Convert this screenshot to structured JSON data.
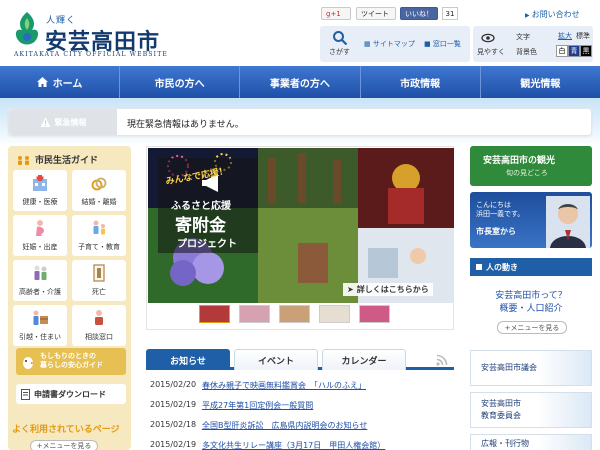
{
  "header": {
    "logo_small": "人輝く",
    "logo_main": "安芸高田市",
    "logo_en": "AKITAKATA CITY OFFICIAL WEBSITE",
    "social": {
      "gplus": "g+1",
      "tweet": "ツイート",
      "like": "いいね！",
      "like_count": "31"
    },
    "contact": "お問い合わせ",
    "search_label": "さがす",
    "sitemap": "サイトマップ",
    "counter": "窓口一覧",
    "view_label": "見やすく",
    "text_label": "文字",
    "bg_label": "背景色",
    "size_big": "拡大",
    "size_std": "標準",
    "bg_white": "白",
    "bg_blue": "青",
    "bg_black": "黒"
  },
  "nav": {
    "items": [
      "ホーム",
      "市民の方へ",
      "事業者の方へ",
      "市政情報",
      "観光情報"
    ]
  },
  "emergency": {
    "label": "緊急情報",
    "text": "現在緊急情報はありません。"
  },
  "sidebar": {
    "title": "市民生活ガイド",
    "tiles": [
      "健康・医療",
      "結婚・離婚",
      "妊娠・出産",
      "子育て・教育",
      "高齢者・介護",
      "死亡",
      "引越・住まい",
      "相談窓口"
    ],
    "banner": "もしもりのときの\n暮らしの安心ガイド",
    "download": "申請書ダウンロード",
    "popular": "よく利用されているページ",
    "menu_button": "メニューを見る"
  },
  "banner": {
    "tagline": "みんなで応援！",
    "headline_1": "ふるさと応援",
    "headline_2": "寄附金",
    "headline_3": "プロジェクト",
    "cta": "詳しくはこちらから"
  },
  "tabs": [
    "お知らせ",
    "イベント",
    "カレンダー"
  ],
  "news": [
    {
      "date": "2015/02/20",
      "title": "春休み親子で映画無料鑑賞会　「ハルのふえ」"
    },
    {
      "date": "2015/02/19",
      "title": "平成27年第1回定例会一般質問"
    },
    {
      "date": "2015/02/18",
      "title": "全国B型肝炎訴訟　広島県内説明会のお知らせ"
    },
    {
      "date": "2015/02/19",
      "title": "多文化共生リレー講座（3月17日　甲田人権会館）"
    }
  ],
  "right": {
    "tour_title": "安芸高田市の観光",
    "tour_sub": "旬の見どころ",
    "mayor_greeting": "こんにちは\n浜田一義です。",
    "mayor_link": "市長室から",
    "movement": "人の動き",
    "about_1": "安芸高田市って？",
    "about_2": "概要・人口紹介",
    "menu_button": "メニューを見る",
    "box_1": "安芸高田市議会",
    "box_2": "安芸高田市\n教育委員会",
    "box_3": "広報・刊行物"
  },
  "colors": {
    "nav": "#2b62c0",
    "sidebar_bg": "#f6e9bf",
    "tour_green": "#2f8a3b",
    "accent_orange": "#e59a12"
  }
}
